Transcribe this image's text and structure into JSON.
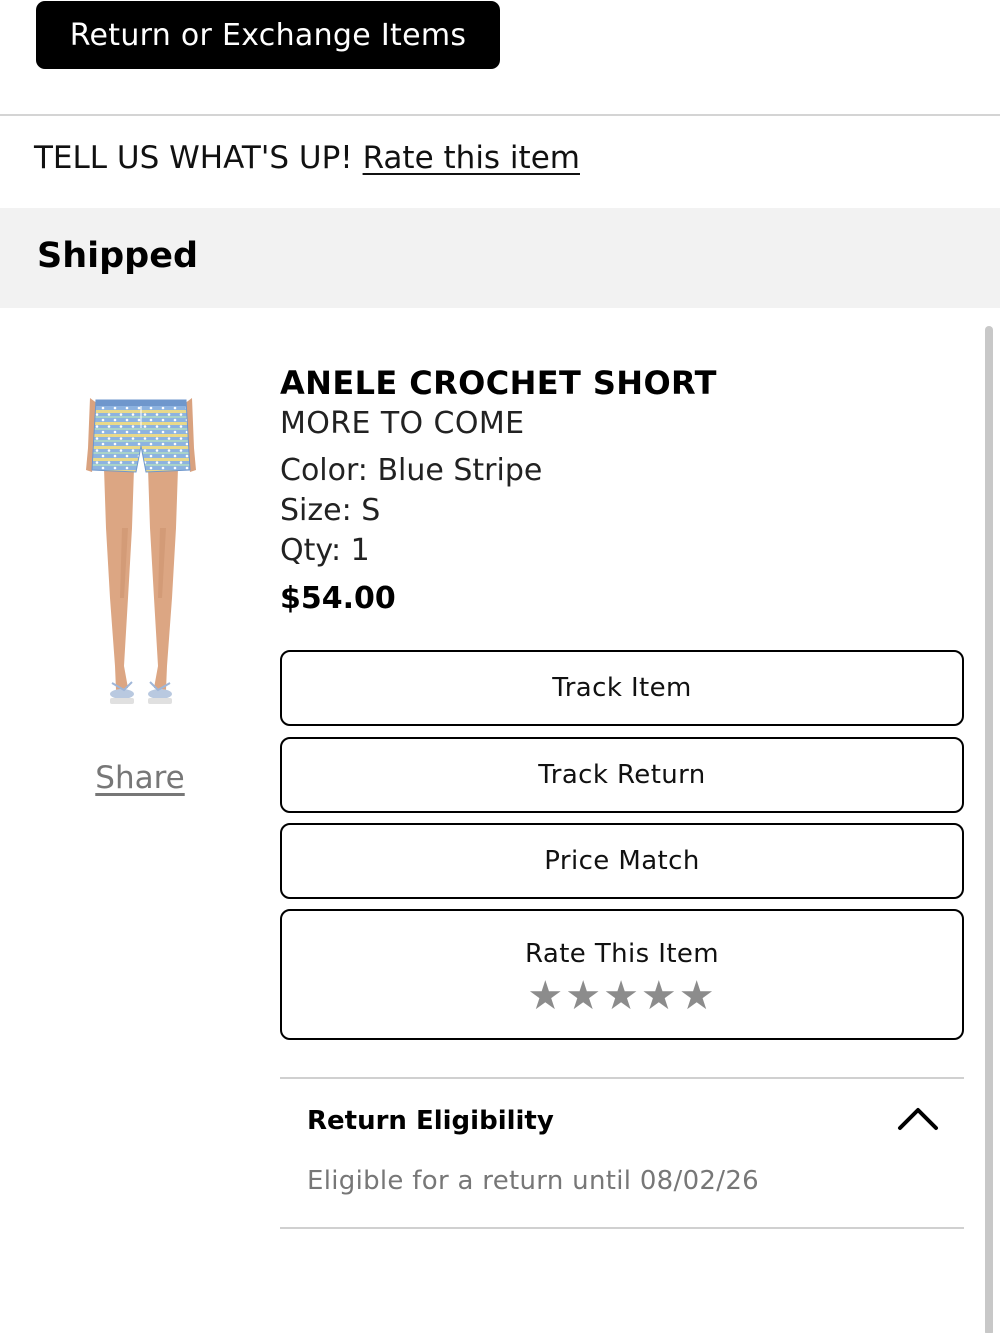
{
  "header": {
    "return_exchange_label": "Return or Exchange Items"
  },
  "feedback": {
    "prompt": "TELL US WHAT'S UP!",
    "link_label": "Rate this item"
  },
  "status": {
    "label": "Shipped"
  },
  "product": {
    "name": "ANELE CROCHET SHORT",
    "brand": "MORE TO COME",
    "color": "Color: Blue Stripe",
    "size": "Size: S",
    "qty": "Qty: 1",
    "price": "$54.00",
    "image_icon": "product-image-crochet-shorts"
  },
  "share_label": "Share",
  "actions": {
    "track_item": "Track Item",
    "track_return": "Track Return",
    "price_match": "Price Match",
    "rate_item": "Rate This Item",
    "star_count": 5,
    "star_glyph": "★"
  },
  "return_eligibility": {
    "title": "Return Eligibility",
    "text": "Eligible for a return until 08/02/26",
    "expanded": true
  },
  "colors": {
    "primary": "#000000",
    "status_bg": "#f2f2f2",
    "muted_text": "#777777",
    "star": "#8c8c8c"
  }
}
